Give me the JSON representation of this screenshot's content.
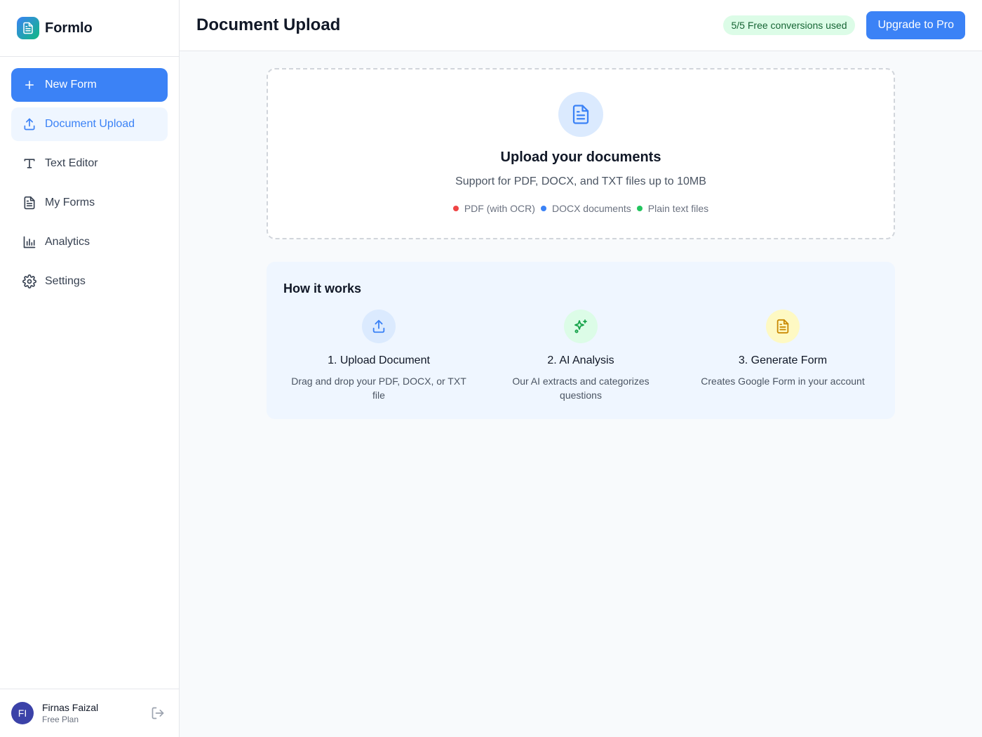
{
  "brand": {
    "name": "Formlo"
  },
  "sidebar": {
    "items": [
      {
        "label": "New Form",
        "icon": "plus-icon"
      },
      {
        "label": "Document Upload",
        "icon": "upload-icon"
      },
      {
        "label": "Text Editor",
        "icon": "text-icon"
      },
      {
        "label": "My Forms",
        "icon": "document-icon"
      },
      {
        "label": "Analytics",
        "icon": "bar-chart-icon"
      },
      {
        "label": "Settings",
        "icon": "gear-icon"
      }
    ]
  },
  "user": {
    "initials": "FI",
    "name": "Firnas Faizal",
    "plan": "Free Plan"
  },
  "header": {
    "title": "Document Upload",
    "badge": "5/5 Free conversions used",
    "upgrade_label": "Upgrade to Pro"
  },
  "upload": {
    "title": "Upload your documents",
    "subtitle": "Support for PDF, DOCX, and TXT files up to 10MB",
    "formats": [
      {
        "label": "PDF (with OCR)",
        "color": "#ef4444"
      },
      {
        "label": "DOCX documents",
        "color": "#3b82f6"
      },
      {
        "label": "Plain text files",
        "color": "#22c55e"
      }
    ]
  },
  "how": {
    "title": "How it works",
    "steps": [
      {
        "title": "1. Upload Document",
        "desc": "Drag and drop your PDF, DOCX, or TXT file",
        "icon": "upload-icon"
      },
      {
        "title": "2. AI Analysis",
        "desc": "Our AI extracts and categorizes questions",
        "icon": "sparkles-icon"
      },
      {
        "title": "3. Generate Form",
        "desc": "Creates Google Form in your account",
        "icon": "document-icon"
      }
    ]
  },
  "colors": {
    "accent": "#3b82f6",
    "active_bg": "#eff6ff",
    "badge_bg": "#dcfce7",
    "badge_text": "#166534"
  }
}
